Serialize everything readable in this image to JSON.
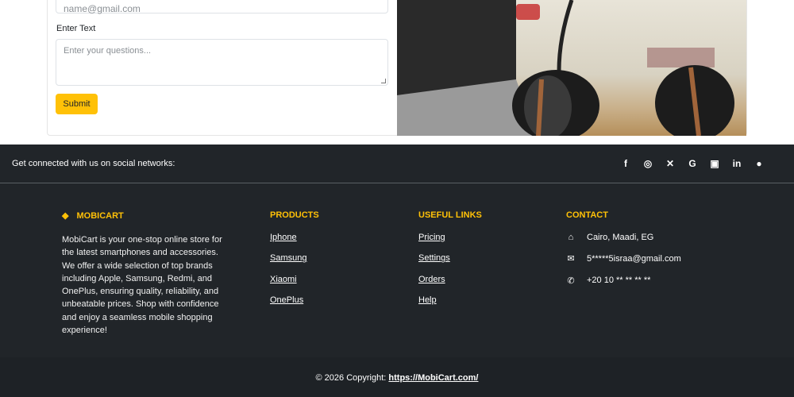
{
  "form": {
    "email_placeholder": "name@gmail.com",
    "text_label": "Enter Text",
    "text_placeholder": "Enter your questions...",
    "submit_label": "Submit"
  },
  "footer": {
    "social_text": "Get connected with us on social networks:",
    "social_icons": [
      "facebook-icon",
      "whatsapp-icon",
      "x-icon",
      "google-icon",
      "instagram-icon",
      "linkedin-icon",
      "github-icon"
    ],
    "brand": {
      "title": "MOBICART",
      "description": "MobiCart is your one-stop online store for the latest smartphones and accessories. We offer a wide selection of top brands including Apple, Samsung, Redmi, and OnePlus, ensuring quality, reliability, and unbeatable prices. Shop with confidence and enjoy a seamless mobile shopping experience!"
    },
    "products": {
      "title": "PRODUCTS",
      "items": [
        "Iphone",
        "Samsung",
        "Xiaomi",
        "OnePlus"
      ]
    },
    "useful_links": {
      "title": "USEFUL LINKS",
      "items": [
        "Pricing",
        "Settings",
        "Orders",
        "Help"
      ]
    },
    "contact": {
      "title": "CONTACT",
      "address": "Cairo, Maadi, EG",
      "email": "5*****5israa@gmail.com",
      "phone": "+20 10 ** ** ** **"
    },
    "copyright": "© 2026 Copyright:",
    "copyright_link": "https://MobiCart.com/"
  },
  "colors": {
    "accent": "#ffc107",
    "footer_bg": "#212529"
  }
}
